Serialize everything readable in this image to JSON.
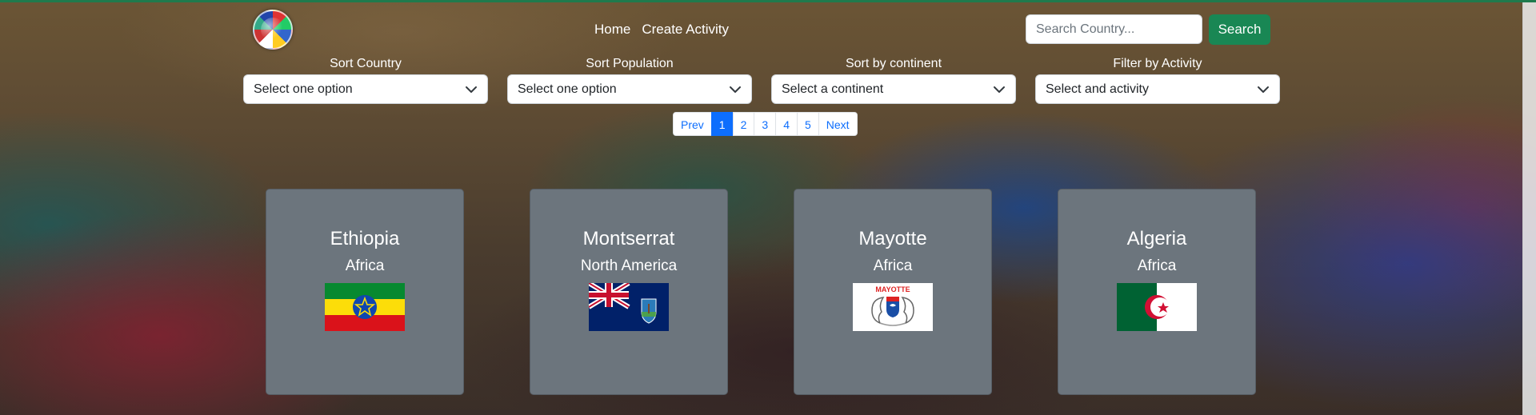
{
  "nav": {
    "home": "Home",
    "create": "Create Activity"
  },
  "search": {
    "placeholder": "Search Country...",
    "button": "Search"
  },
  "filters": [
    {
      "label": "Sort Country",
      "value": "Select one option"
    },
    {
      "label": "Sort Population",
      "value": "Select one option"
    },
    {
      "label": "Sort by continent",
      "value": "Select a continent"
    },
    {
      "label": "Filter by Activity",
      "value": "Select and activity"
    }
  ],
  "pagination": {
    "prev": "Prev",
    "pages": [
      "1",
      "2",
      "3",
      "4",
      "5"
    ],
    "active": "1",
    "next": "Next"
  },
  "cards": [
    {
      "name": "Ethiopia",
      "continent": "Africa",
      "flag": "ethiopia-flag"
    },
    {
      "name": "Montserrat",
      "continent": "North America",
      "flag": "montserrat-flag"
    },
    {
      "name": "Mayotte",
      "continent": "Africa",
      "flag": "mayotte-flag",
      "flag_text": "MAYOTTE"
    },
    {
      "name": "Algeria",
      "continent": "Africa",
      "flag": "algeria-flag"
    }
  ],
  "colors": {
    "accent": "#198754",
    "card": "#6c757d",
    "link": "#0d6efd"
  }
}
